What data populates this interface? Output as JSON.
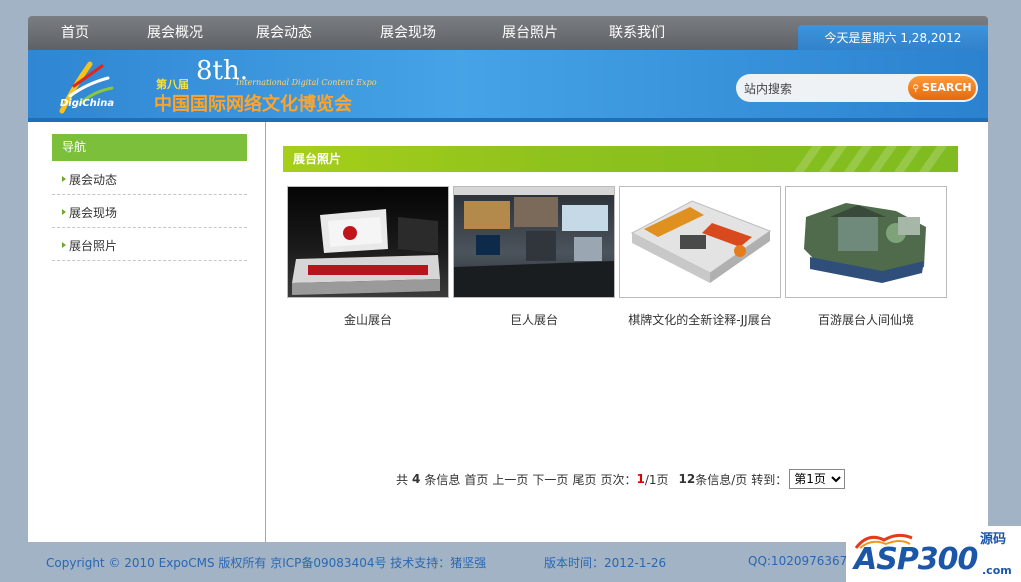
{
  "topnav": {
    "items": [
      "首页",
      "展会概况",
      "展会动态",
      "展会现场",
      "展台照片",
      "联系我们"
    ],
    "date_text": "今天是星期六  1,28,2012"
  },
  "banner": {
    "logo_text": "DigiChina",
    "edition": "第八届",
    "number": "8th.",
    "english_title": "International Digital Content Expo",
    "chinese_title": "中国国际网络文化博览会"
  },
  "search": {
    "value": "站内搜索",
    "button_label": "SEARCH"
  },
  "sidebar": {
    "title": "导航",
    "items": [
      {
        "label": "展会动态"
      },
      {
        "label": "展会现场"
      },
      {
        "label": "展台照片"
      }
    ]
  },
  "section": {
    "title": "展台照片"
  },
  "photos": [
    {
      "caption": "金山展台"
    },
    {
      "caption": "巨人展台"
    },
    {
      "caption": "棋牌文化的全新诠释-JJ展台"
    },
    {
      "caption": "百游展台人间仙境"
    }
  ],
  "pager": {
    "total_prefix": "共",
    "total_count": "4",
    "total_suffix": "条信息",
    "first": "首页",
    "prev": "上一页",
    "next": "下一页",
    "last": "尾页",
    "page_prefix": "页次：",
    "current": "1",
    "page_total": "/1页",
    "per_page_count": "12",
    "per_page_suffix": "条信息/页",
    "goto": "转到：",
    "select_value": "第1页"
  },
  "footer": {
    "copyright": "Copyright © 2010 ExpoCMS 版权所有  京ICP备09083404号  技术支持：猪坚强",
    "version": "版本时间：2012-1-26",
    "qq": "QQ:1020976367"
  },
  "watermark": {
    "text": "ASP300",
    "sub": "源码",
    "domain": ".com"
  },
  "colors": {
    "nav_bg": "#6c6f73",
    "banner_blue": "#2f86d2",
    "section_green": "#8fc21c",
    "sidebar_green": "#7bbf3a",
    "search_orange": "#f08020",
    "footer_link": "#2867b2",
    "current_page_red": "#d80000"
  }
}
